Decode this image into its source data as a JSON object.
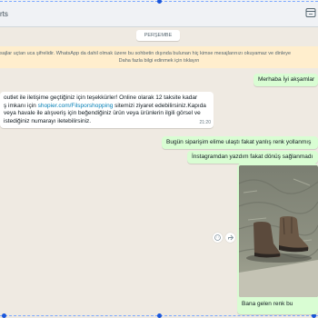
{
  "header": {
    "title": "rts",
    "icon": "side-panel-icon"
  },
  "chat": {
    "date_chip": "PERŞEMBE",
    "notice_line1": "sajlar uçtan uca şifrelidir. WhatsApp da dahil olmak üzere bu sohbetin dışında bulunan hiç kimse mesajlarınızı okuyamaz ve dinleye",
    "notice_line2": "Daha fazla bilgi edinmek için tıklayın",
    "messages": [
      {
        "text": "Merhaba İyi akşamlar"
      },
      {
        "line1": "outlet ile iletişime geçtiğiniz için teşekkürler! Online olarak 12 taksite kadar",
        "line2_pre": "ş imkanı için ",
        "link": "shopier.com/Filsporshopping",
        "line2_post": " sitemizi ziyaret edebilirsiniz.Kapıda",
        "line3": "veya havale ile alışveriş için beğendiğiniz ürün veya ürünlerin ilgili görsel ve",
        "line4": "istediğiniz numarayı iletebilirsiniz.",
        "time": "21:20"
      },
      {
        "text": "Bugün siparişim elime ulaştı fakat yanlış renk yollanmış"
      },
      {
        "text": "İnstagramdan yazdım fakat dönüş sağlanmadı"
      },
      {
        "caption": "Bana gelen renk bu"
      }
    ]
  },
  "colors": {
    "chat_background": "#efeae2",
    "outgoing_bubble": "#d9fdd3",
    "incoming_bubble": "#ffffff",
    "notice_background": "#ffeecd",
    "link": "#027eb5"
  }
}
